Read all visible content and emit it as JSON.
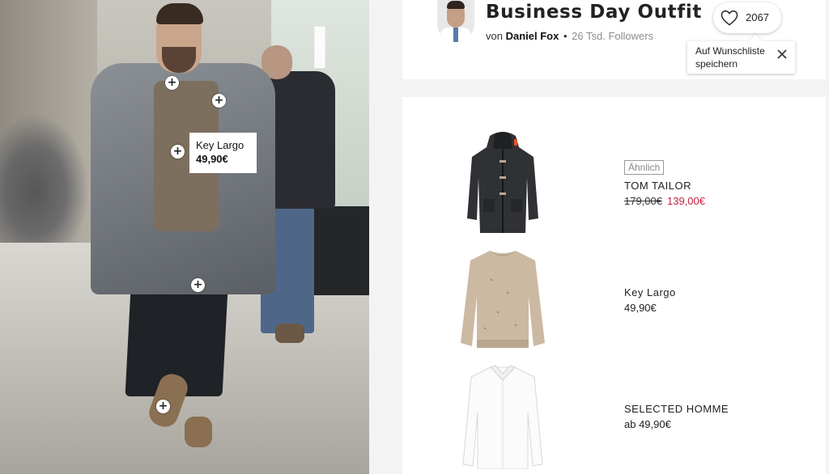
{
  "photo": {
    "tag": {
      "name": "Key Largo",
      "price": "49,90€"
    },
    "hotspot_symbol": "+",
    "sign_letter": "I"
  },
  "outfit": {
    "title": "Business Day Outfit",
    "by_prefix": "von",
    "author": "Daniel Fox",
    "separator": "•",
    "followers": "26 Tsd. Followers",
    "likes": "2067"
  },
  "wishlist_tooltip": {
    "text": "Auf Wunschliste speichern"
  },
  "products": [
    {
      "badge": "Ähnlich",
      "brand": "TOM TAILOR",
      "old_price": "179,00€",
      "price": "139,00€",
      "image_icon": "duffle-coat"
    },
    {
      "brand": "Key Largo",
      "price": "49,90€",
      "image_icon": "knit-sweater"
    },
    {
      "brand": "SELECTED HOMME",
      "price": "ab 49,90€",
      "image_icon": "white-shirt"
    }
  ],
  "colors": {
    "sale": "#c41f3e",
    "background": "#f3f3f3"
  }
}
